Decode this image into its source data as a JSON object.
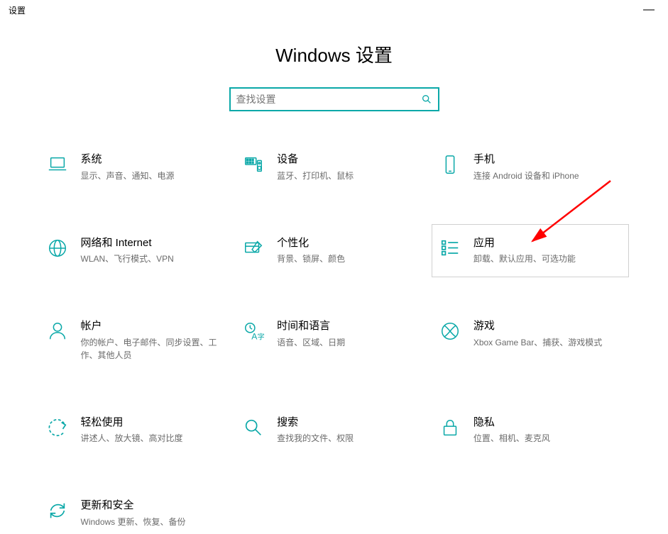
{
  "titlebar": {
    "title": "设置"
  },
  "page_title": "Windows 设置",
  "search": {
    "placeholder": "查找设置"
  },
  "cards": {
    "system": {
      "label": "系统",
      "desc": "显示、声音、通知、电源"
    },
    "devices": {
      "label": "设备",
      "desc": "蓝牙、打印机、鼠标"
    },
    "phone": {
      "label": "手机",
      "desc": "连接 Android 设备和 iPhone"
    },
    "network": {
      "label": "网络和 Internet",
      "desc": "WLAN、飞行模式、VPN"
    },
    "personalize": {
      "label": "个性化",
      "desc": "背景、锁屏、颜色"
    },
    "apps": {
      "label": "应用",
      "desc": "卸载、默认应用、可选功能"
    },
    "accounts": {
      "label": "帐户",
      "desc": "你的帐户、电子邮件、同步设置、工作、其他人员"
    },
    "time": {
      "label": "时间和语言",
      "desc": "语音、区域、日期"
    },
    "gaming": {
      "label": "游戏",
      "desc": "Xbox Game Bar、捕获、游戏模式"
    },
    "ease": {
      "label": "轻松使用",
      "desc": "讲述人、放大镜、高对比度"
    },
    "search_cat": {
      "label": "搜索",
      "desc": "查找我的文件、权限"
    },
    "privacy": {
      "label": "隐私",
      "desc": "位置、相机、麦克风"
    },
    "update": {
      "label": "更新和安全",
      "desc": "Windows 更新、恢复、备份"
    }
  },
  "colors": {
    "accent": "#0aa8a8",
    "annotation": "#ff0000"
  }
}
